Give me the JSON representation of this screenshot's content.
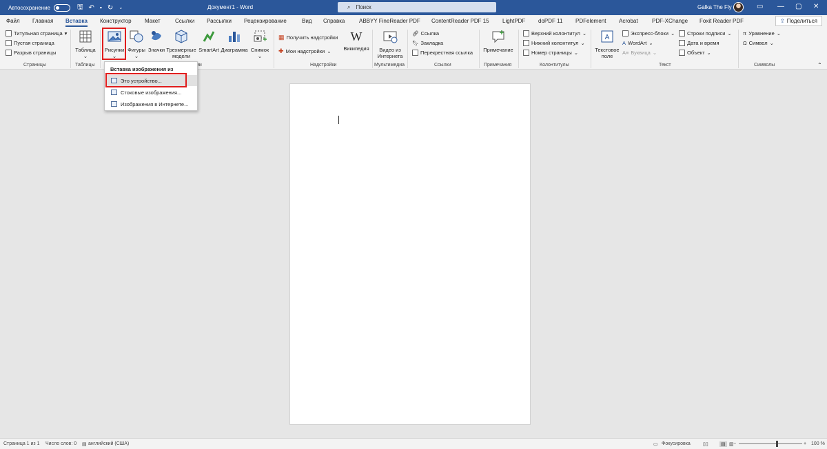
{
  "titlebar": {
    "autosave_label": "Автосохранение",
    "doc_title": "Документ1 - Word",
    "search_placeholder": "Поиск",
    "user_name": "Galka The Fly"
  },
  "tabs": [
    "Файл",
    "Главная",
    "Вставка",
    "Конструктор",
    "Макет",
    "Ссылки",
    "Рассылки",
    "Рецензирование",
    "Вид",
    "Справка",
    "ABBYY FineReader PDF",
    "ContentReader PDF 15",
    "LightPDF",
    "doPDF 11",
    "PDFelement",
    "Acrobat",
    "PDF-XChange",
    "Foxit Reader PDF"
  ],
  "active_tab": "Вставка",
  "share_label": "Поделиться",
  "ribbon": {
    "pages": {
      "items": [
        "Титульная страница",
        "Пустая страница",
        "Разрыв страницы"
      ],
      "label": "Страницы"
    },
    "tables": {
      "button": "Таблица",
      "label": "Таблицы"
    },
    "illustrations": {
      "buttons": [
        "Рисунки",
        "Фигуры",
        "Значки",
        "Трехмерные модели",
        "SmartArt",
        "Диаграмма",
        "Снимок"
      ],
      "label_tail": "ии"
    },
    "addins": {
      "items": [
        "Получить надстройки",
        "Мои надстройки"
      ],
      "wiki": "Википедия",
      "label": "Надстройки"
    },
    "media": {
      "button": "Видео из Интернета",
      "label": "Мультимедиа"
    },
    "links": {
      "items": [
        "Ссылка",
        "Закладка",
        "Перекрестная ссылка"
      ],
      "label": "Ссылки"
    },
    "comments": {
      "button": "Примечание",
      "label": "Примечания"
    },
    "headerfooter": {
      "items": [
        "Верхний колонтитул",
        "Нижний колонтитул",
        "Номер страницы"
      ],
      "label": "Колонтитулы"
    },
    "text": {
      "textbox": "Текстовое поле",
      "items_a": [
        "Экспресс-блоки",
        "WordArt",
        "Буквица"
      ],
      "items_b": [
        "Строки подписи",
        "Дата и время",
        "Объект"
      ],
      "label": "Текст"
    },
    "symbols": {
      "items": [
        "Уравнение",
        "Символ"
      ],
      "label": "Символы"
    }
  },
  "dropdown": {
    "header": "Вставка изображения из",
    "items": [
      "Это устройство...",
      "Стоковые изображения...",
      "Изображения в Интернете..."
    ]
  },
  "statusbar": {
    "page": "Страница 1 из 1",
    "words": "Число слов: 0",
    "language": "английский (США)",
    "focus": "Фокусировка",
    "zoom": "100 %"
  }
}
